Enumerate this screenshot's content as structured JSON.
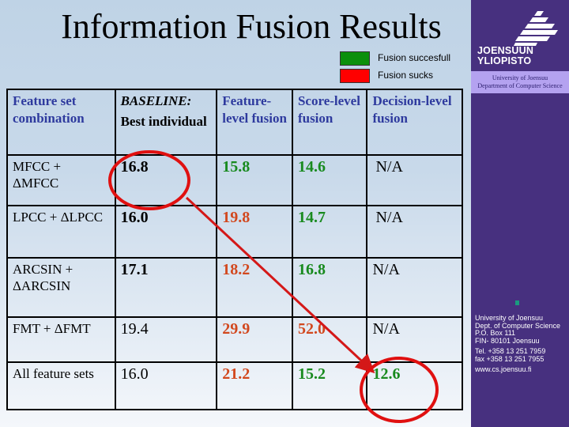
{
  "title": "Information Fusion Results",
  "legend": [
    {
      "label": "Fusion succesfull",
      "color": "#0b8f0b"
    },
    {
      "label": "Fusion sucks",
      "color": "#ff0000"
    }
  ],
  "sidebar": {
    "logo_line1": "JOENSUUN",
    "logo_line2": "YLIOPISTO",
    "dept_line1": "University of Joensuu",
    "dept_line2": "Department of Computer Science",
    "contact": [
      "University of Joensuu",
      "Dept. of Computer Science",
      "P.O. Box 111",
      "FIN- 80101 Joensuu"
    ],
    "phone": "Tel. +358 13 251 7959",
    "fax": "fax  +358 13 251 7955",
    "web": "www.cs.joensuu.fi"
  },
  "table": {
    "headers": {
      "feature_set": "Feature set combination",
      "baseline_top": "BASELINE:",
      "baseline_bottom": "Best individual",
      "feature_level": "Feature-level fusion",
      "score_level": "Score-level fusion",
      "decision_level": "Decision-level fusion"
    },
    "rows": [
      {
        "feature": "MFCC + ΔMFCC",
        "baseline": "16.8",
        "feature_level": "15.8",
        "feature_status": "good",
        "score_level": "14.6",
        "score_status": "good",
        "decision_level": "N/A",
        "decision_status": "na"
      },
      {
        "feature": "LPCC + ΔLPCC",
        "baseline": "16.0",
        "feature_level": "19.8",
        "feature_status": "bad",
        "score_level": "14.7",
        "score_status": "good",
        "decision_level": "N/A",
        "decision_status": "na"
      },
      {
        "feature": "ARCSIN + ΔARCSIN",
        "baseline": "17.1",
        "feature_level": "18.2",
        "feature_status": "bad",
        "score_level": "16.8",
        "score_status": "good",
        "decision_level": "N/A",
        "decision_status": "na"
      },
      {
        "feature": "FMT + ΔFMT",
        "baseline": "19.4",
        "feature_level": "29.9",
        "feature_status": "bad",
        "score_level": "52.0",
        "score_status": "bad",
        "decision_level": "N/A",
        "decision_status": "na"
      },
      {
        "feature": "All feature sets",
        "baseline": "16.0",
        "feature_level": "21.2",
        "feature_status": "bad",
        "score_level": "15.2",
        "score_status": "good",
        "decision_level": "12.6",
        "decision_status": "good"
      }
    ]
  },
  "annotations": {
    "highlight_from": "16.8 (MFCC + ΔMFCC baseline)",
    "highlight_to": "12.6 (All feature sets decision-level)",
    "color": "#e01010"
  }
}
